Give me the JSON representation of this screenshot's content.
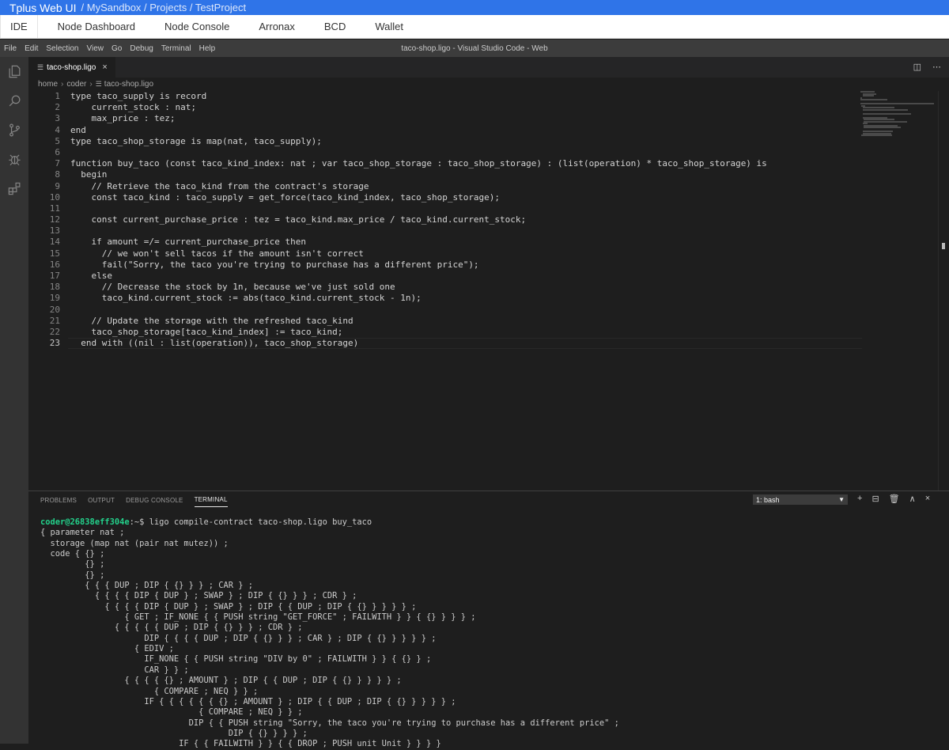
{
  "topbar": {
    "app_name": "Tplus Web UI",
    "breadcrumb": "/ MySandbox / Projects / TestProject"
  },
  "nav": {
    "tabs": [
      {
        "label": "IDE"
      },
      {
        "label": "Node Dashboard"
      },
      {
        "label": "Node Console"
      },
      {
        "label": "Arronax"
      },
      {
        "label": "BCD"
      },
      {
        "label": "Wallet"
      }
    ]
  },
  "menu": {
    "items": [
      "File",
      "Edit",
      "Selection",
      "View",
      "Go",
      "Debug",
      "Terminal",
      "Help"
    ],
    "window_title": "taco-shop.ligo - Visual Studio Code - Web"
  },
  "activity_bar": {
    "icons": [
      "explorer-icon",
      "search-icon",
      "source-control-icon",
      "debug-icon",
      "extensions-icon"
    ]
  },
  "editor": {
    "tab_label": "taco-shop.ligo",
    "close_glyph": "×",
    "breadcrumbs": [
      "home",
      "coder",
      "taco-shop.ligo"
    ],
    "current_line": 23,
    "lines": [
      {
        "n": "1",
        "text": "type taco_supply is record"
      },
      {
        "n": "2",
        "text": "    current_stock : nat;"
      },
      {
        "n": "3",
        "text": "    max_price : tez;"
      },
      {
        "n": "4",
        "text": "end"
      },
      {
        "n": "5",
        "text": "type taco_shop_storage is map(nat, taco_supply);"
      },
      {
        "n": "6",
        "text": ""
      },
      {
        "n": "7",
        "text": "function buy_taco (const taco_kind_index: nat ; var taco_shop_storage : taco_shop_storage) : (list(operation) * taco_shop_storage) is"
      },
      {
        "n": "8",
        "text": "  begin"
      },
      {
        "n": "9",
        "text": "    // Retrieve the taco_kind from the contract's storage"
      },
      {
        "n": "10",
        "text": "    const taco_kind : taco_supply = get_force(taco_kind_index, taco_shop_storage);"
      },
      {
        "n": "11",
        "text": ""
      },
      {
        "n": "12",
        "text": "    const current_purchase_price : tez = taco_kind.max_price / taco_kind.current_stock;"
      },
      {
        "n": "13",
        "text": ""
      },
      {
        "n": "14",
        "text": "    if amount =/= current_purchase_price then"
      },
      {
        "n": "15",
        "text": "      // we won't sell tacos if the amount isn't correct"
      },
      {
        "n": "16",
        "text": "      fail(\"Sorry, the taco you're trying to purchase has a different price\");"
      },
      {
        "n": "17",
        "text": "    else"
      },
      {
        "n": "18",
        "text": "      // Decrease the stock by 1n, because we've just sold one"
      },
      {
        "n": "19",
        "text": "      taco_kind.current_stock := abs(taco_kind.current_stock - 1n);"
      },
      {
        "n": "20",
        "text": ""
      },
      {
        "n": "21",
        "text": "    // Update the storage with the refreshed taco_kind"
      },
      {
        "n": "22",
        "text": "    taco_shop_storage[taco_kind_index] := taco_kind;"
      },
      {
        "n": "23",
        "text": "  end with ((nil : list(operation)), taco_shop_storage)"
      }
    ]
  },
  "panel": {
    "tabs": [
      "PROBLEMS",
      "OUTPUT",
      "DEBUG CONSOLE",
      "TERMINAL"
    ],
    "active_tab": "TERMINAL",
    "terminal_select": "1: bash",
    "actions": [
      "+",
      "⊟",
      "🗑",
      "∧",
      "×"
    ],
    "prompt_user": "coder@26838eff304e",
    "prompt_path": ":~$ ",
    "command": "ligo compile-contract taco-shop.ligo buy_taco",
    "output": [
      "{ parameter nat ;",
      "  storage (map nat (pair nat mutez)) ;",
      "  code { {} ;",
      "         {} ;",
      "         {} ;",
      "         { { { DUP ; DIP { {} } } ; CAR } ;",
      "           { { { { DIP { DUP } ; SWAP } ; DIP { {} } } ; CDR } ;",
      "             { { { { DIP { DUP } ; SWAP } ; DIP { { DUP ; DIP { {} } } } } ;",
      "                 { GET ; IF_NONE { { PUSH string \"GET_FORCE\" ; FAILWITH } } { {} } } } ;",
      "               { { { { { DUP ; DIP { {} } } ; CDR } ;",
      "                     DIP { { { { DUP ; DIP { {} } } ; CAR } ; DIP { {} } } } } ;",
      "                   { EDIV ;",
      "                     IF_NONE { { PUSH string \"DIV by 0\" ; FAILWITH } } { {} } ;",
      "                     CAR } } ;",
      "                 { { { { {} ; AMOUNT } ; DIP { { DUP ; DIP { {} } } } } ;",
      "                       { COMPARE ; NEQ } } ;",
      "                     IF { { { { { { {} ; AMOUNT } ; DIP { { DUP ; DIP { {} } } } } ;",
      "                                { COMPARE ; NEQ } } ;",
      "                              DIP { { PUSH string \"Sorry, the taco you're trying to purchase has a different price\" ;",
      "                                      DIP { {} } } } ;",
      "                            IF { { FAILWITH } } { { DROP ; PUSH unit Unit } } } }"
    ]
  },
  "colors": {
    "topbar_bg": "#2f74e8",
    "editor_bg": "#1e1e1e",
    "menubar_bg": "#3c3c3c",
    "activity_bg": "#333333",
    "prompt_user": "#23d18b"
  }
}
